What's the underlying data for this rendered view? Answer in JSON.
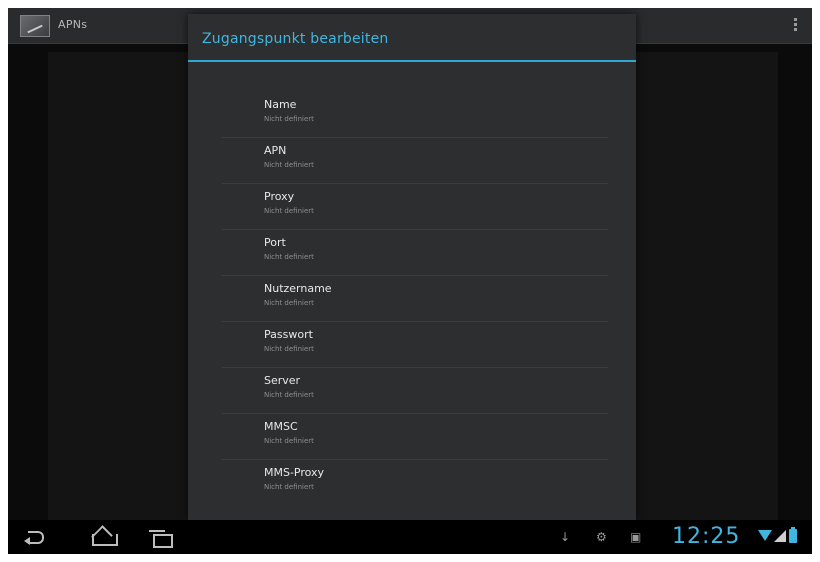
{
  "actionbar": {
    "title": "APNs"
  },
  "dialog": {
    "title": "Zugangspunkt bearbeiten",
    "fields": [
      {
        "label": "Name",
        "value": "Nicht definiert"
      },
      {
        "label": "APN",
        "value": "Nicht definiert"
      },
      {
        "label": "Proxy",
        "value": "Nicht definiert"
      },
      {
        "label": "Port",
        "value": "Nicht definiert"
      },
      {
        "label": "Nutzername",
        "value": "Nicht definiert"
      },
      {
        "label": "Passwort",
        "value": "Nicht definiert"
      },
      {
        "label": "Server",
        "value": "Nicht definiert"
      },
      {
        "label": "MMSC",
        "value": "Nicht definiert"
      },
      {
        "label": "MMS-Proxy",
        "value": "Nicht definiert"
      }
    ]
  },
  "statusbar": {
    "clock": "12:25",
    "icons": [
      "usb-icon",
      "android-icon",
      "sd-card-icon",
      "wifi-icon",
      "signal-icon",
      "battery-icon"
    ]
  },
  "colors": {
    "accent": "#3fb6e0",
    "dialog_bg": "#2d2e30",
    "screen_bg": "#0b0b0b"
  }
}
